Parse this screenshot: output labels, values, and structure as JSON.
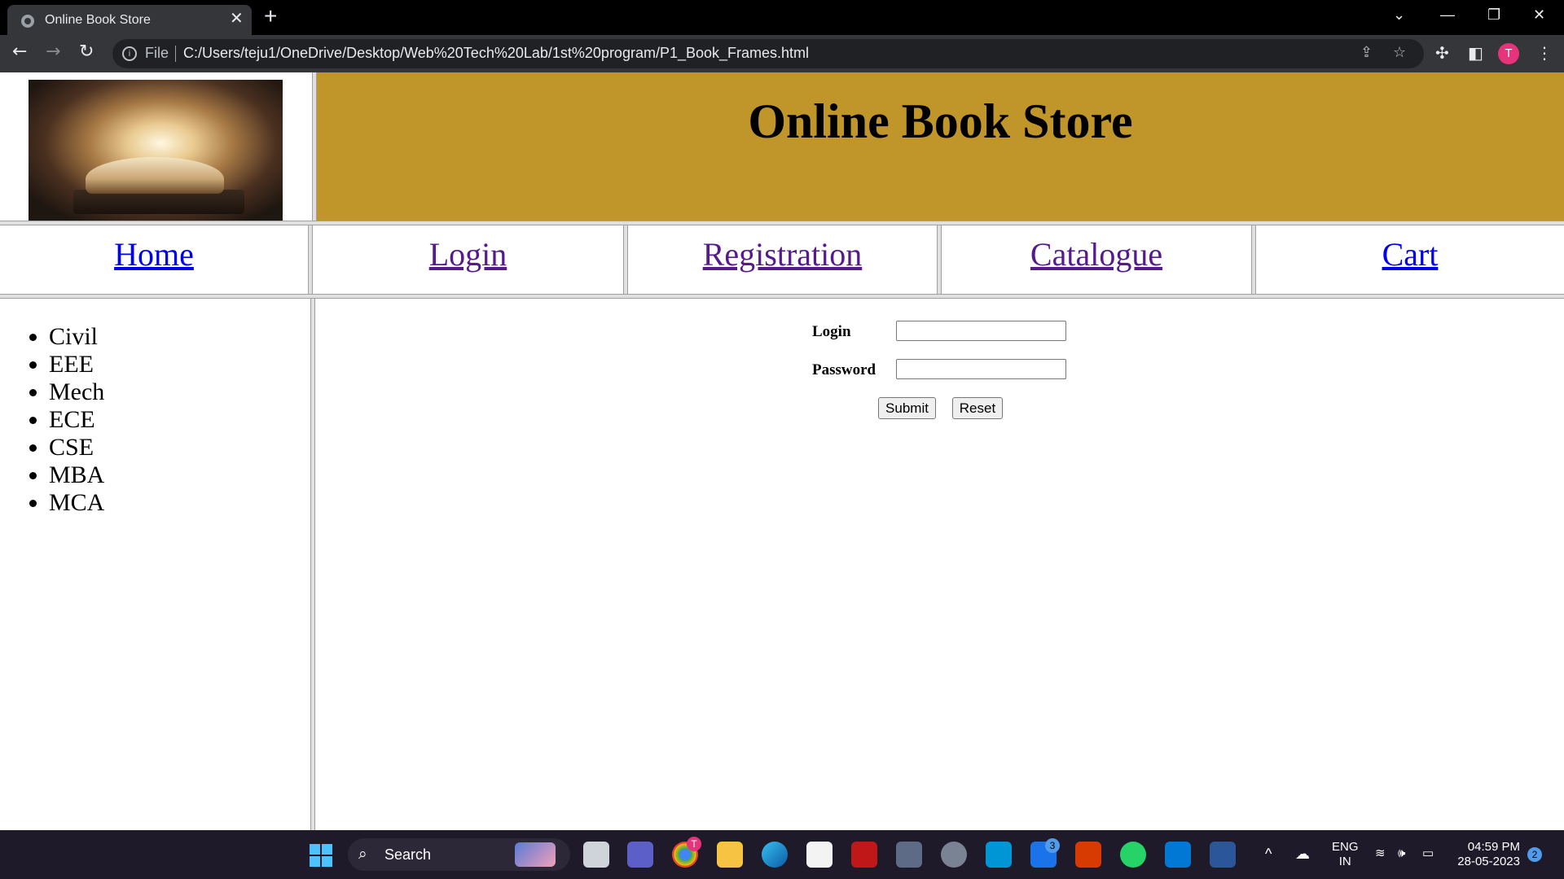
{
  "browser": {
    "tab_title": "Online Book Store",
    "tab_close": "✕",
    "new_tab": "+",
    "file_label": "File",
    "url": "C:/Users/teju1/OneDrive/Desktop/Web%20Tech%20Lab/1st%20program/P1_Book_Frames.html",
    "profile_initial": "T"
  },
  "header": {
    "title": "Online Book Store"
  },
  "nav": {
    "items": [
      {
        "label": "Home"
      },
      {
        "label": "Login"
      },
      {
        "label": "Registration"
      },
      {
        "label": "Catalogue"
      },
      {
        "label": "Cart"
      }
    ]
  },
  "sidebar": {
    "departments": [
      "Civil",
      "EEE",
      "Mech",
      "ECE",
      "CSE",
      "MBA",
      "MCA"
    ]
  },
  "login_form": {
    "login_label": "Login",
    "password_label": "Password",
    "login_value": "",
    "password_value": "",
    "submit_label": "Submit",
    "reset_label": "Reset"
  },
  "taskbar": {
    "search_placeholder": "Search",
    "language_line1": "ENG",
    "language_line2": "IN",
    "time": "04:59 PM",
    "date": "28-05-2023",
    "notification_count": "2",
    "mail_badge": "3",
    "chrome_badge": "T"
  }
}
